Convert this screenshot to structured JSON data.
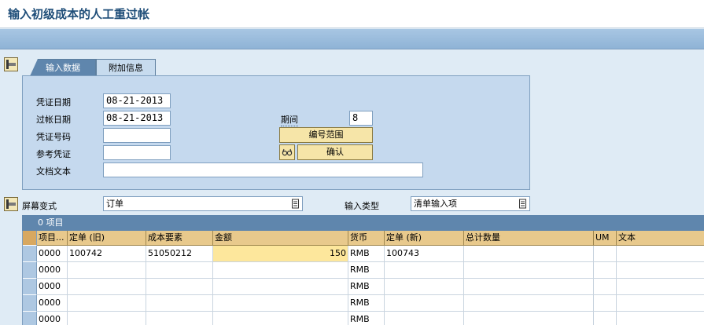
{
  "window": {
    "title": "输入初级成本的人工重过帐"
  },
  "tabs": [
    {
      "label": "输入数据"
    },
    {
      "label": "附加信息"
    }
  ],
  "form": {
    "doc_date": {
      "label": "凭证日期",
      "value": "08-21-2013"
    },
    "posting_date": {
      "label": "过帐日期",
      "value": "08-21-2013"
    },
    "doc_number": {
      "label": "凭证号码",
      "value": ""
    },
    "ref_doc": {
      "label": "参考凭证",
      "value": ""
    },
    "doc_text": {
      "label": "文档文本",
      "value": ""
    },
    "period": {
      "label": "期间",
      "value": "8"
    },
    "number_range_button": "编号范围",
    "confirm_button": "确认"
  },
  "screen_variant": {
    "label": "屏幕变式",
    "value": "订单"
  },
  "input_type": {
    "label": "输入类型",
    "value": "清单输入项"
  },
  "grid": {
    "title": "0 项目",
    "columns": [
      "项目...",
      "定单 (旧)",
      "成本要素",
      "金额",
      "货币",
      "定单 (新)",
      "总计数量",
      "UM",
      "文本"
    ],
    "rows": [
      {
        "item": "0000",
        "old_order": "100742",
        "cost_element": "51050212",
        "amount": "150",
        "currency": "RMB",
        "new_order": "100743",
        "qty": "",
        "um": "",
        "text": ""
      },
      {
        "item": "0000",
        "old_order": "",
        "cost_element": "",
        "amount": "",
        "currency": "RMB",
        "new_order": "",
        "qty": "",
        "um": "",
        "text": ""
      },
      {
        "item": "0000",
        "old_order": "",
        "cost_element": "",
        "amount": "",
        "currency": "RMB",
        "new_order": "",
        "qty": "",
        "um": "",
        "text": ""
      },
      {
        "item": "0000",
        "old_order": "",
        "cost_element": "",
        "amount": "",
        "currency": "RMB",
        "new_order": "",
        "qty": "",
        "um": "",
        "text": ""
      },
      {
        "item": "0000",
        "old_order": "",
        "cost_element": "",
        "amount": "",
        "currency": "RMB",
        "new_order": "",
        "qty": "",
        "um": "",
        "text": ""
      }
    ]
  },
  "icons": {
    "collapse": "collapse-panel-icon",
    "dropdown": "dropdown-list-icon",
    "glasses": "display-glasses-icon"
  }
}
